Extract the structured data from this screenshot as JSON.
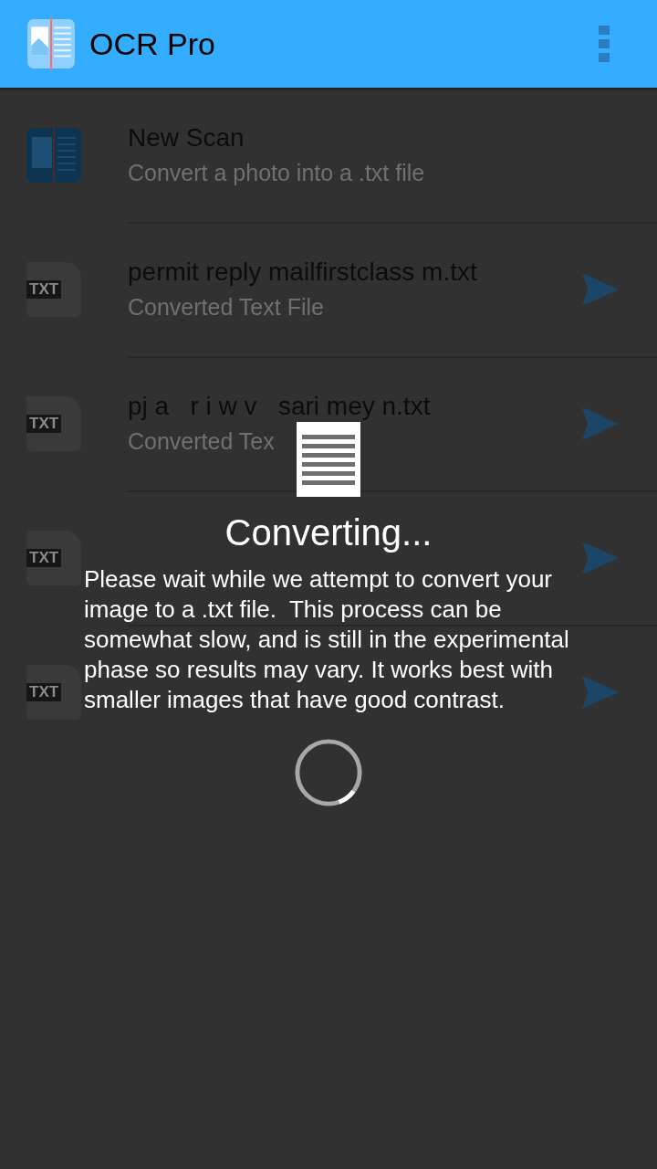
{
  "app_bar": {
    "title": "OCR Pro"
  },
  "list": [
    {
      "kind": "scan",
      "title": "New Scan",
      "subtitle": "Convert a photo into a .txt file"
    },
    {
      "kind": "file",
      "icon_label": "TXT",
      "title": "permit reply mailfirstclass m.txt",
      "subtitle": "Converted Text File"
    },
    {
      "kind": "file",
      "icon_label": "TXT",
      "title": "pj a   r i w v   sari mey n.txt",
      "subtitle": "Converted Tex"
    },
    {
      "kind": "file",
      "icon_label": "TXT"
    },
    {
      "kind": "file",
      "icon_label": "TXT"
    }
  ],
  "dialog": {
    "title": "Converting...",
    "message": "Please wait while we attempt to convert your image to a .txt file.  This process can be somewhat slow, and is still in the experimental phase so results may vary. It works best with smaller images that have good contrast."
  }
}
